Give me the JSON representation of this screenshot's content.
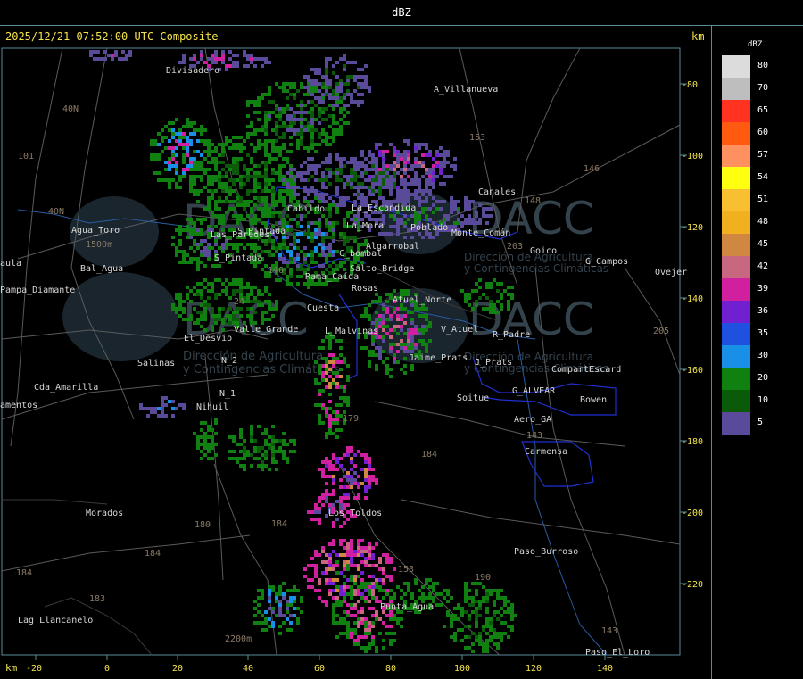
{
  "header": {
    "units_title": "dBZ",
    "timestamp_line": "2025/12/21 07:52:00 UTC Composite",
    "km_top": "km",
    "km_bottom": "km"
  },
  "legend": {
    "title": "dBZ",
    "entries": [
      {
        "label": "80",
        "color": "#dcdcdc"
      },
      {
        "label": "70",
        "color": "#bebebe"
      },
      {
        "label": "65",
        "color": "#ff3320"
      },
      {
        "label": "60",
        "color": "#ff5a10"
      },
      {
        "label": "57",
        "color": "#ff9060"
      },
      {
        "label": "54",
        "color": "#ffff10"
      },
      {
        "label": "51",
        "color": "#f8c030"
      },
      {
        "label": "48",
        "color": "#f0b020"
      },
      {
        "label": "45",
        "color": "#d08840"
      },
      {
        "label": "42",
        "color": "#c86880"
      },
      {
        "label": "39",
        "color": "#d020a0"
      },
      {
        "label": "36",
        "color": "#7020d0"
      },
      {
        "label": "35",
        "color": "#2050e0"
      },
      {
        "label": "30",
        "color": "#1890e8"
      },
      {
        "label": "20",
        "color": "#108010"
      },
      {
        "label": "10",
        "color": "#0a5a0a"
      },
      {
        "label": "5",
        "color": "#5a4a9a"
      }
    ]
  },
  "axes": {
    "x_ticks": [
      "-20",
      "0",
      "20",
      "40",
      "60",
      "80",
      "100",
      "120",
      "140"
    ],
    "y_ticks": [
      "-80",
      "-100",
      "-120",
      "-140",
      "-160",
      "-180",
      "-200",
      "-220"
    ]
  },
  "places": [
    "Divisadero",
    "A_Villanueva",
    "Agua_Toro",
    "Pampa_Diamante",
    "Cda_Amarilla",
    "amentos",
    "aula",
    "El_Desvio",
    "Salinas",
    "Valle_Grande",
    "N_2",
    "N_1",
    "Nihuil",
    "Morados",
    "Lag_Llancanelo",
    "S_Pintada",
    "Rosas",
    "Atuel_Norte",
    "L_Malvinas",
    "V_Atuel",
    "R_Padre",
    "J_Prats",
    "CompartEscard",
    "G_ALVEAR",
    "Bowen",
    "Soitue",
    "Aero_GA",
    "Carmensa",
    "Goico",
    "G_Campos",
    "Ovejer",
    "Canales",
    "Los_Toldos",
    "Punta_Agua",
    "Paso_Burroso",
    "Paso_El_Loro",
    "La_Mora",
    "La_Escandida",
    "Cabildo",
    "Monte_Comán",
    "C_bombal",
    "Algarrobal",
    "Salto_Bridge",
    "Cuesta",
    "Rama_Caída",
    "Poblado",
    "Bal_Agua",
    "Las_Paredes",
    "S_Pintada",
    "Jaime_Prats"
  ],
  "road_numbers": [
    "40N",
    "101",
    "40N",
    "153",
    "146",
    "148",
    "203",
    "205",
    "24",
    "184",
    "179",
    "184",
    "180",
    "184",
    "183",
    "184",
    "153",
    "190",
    "143",
    "143",
    "146"
  ],
  "elevation_labels": [
    "1500m",
    "2200m"
  ],
  "watermark": {
    "name": "DACC",
    "line1": "Dirección de Agricultura",
    "line2": "y Contingencias Climáticas"
  }
}
